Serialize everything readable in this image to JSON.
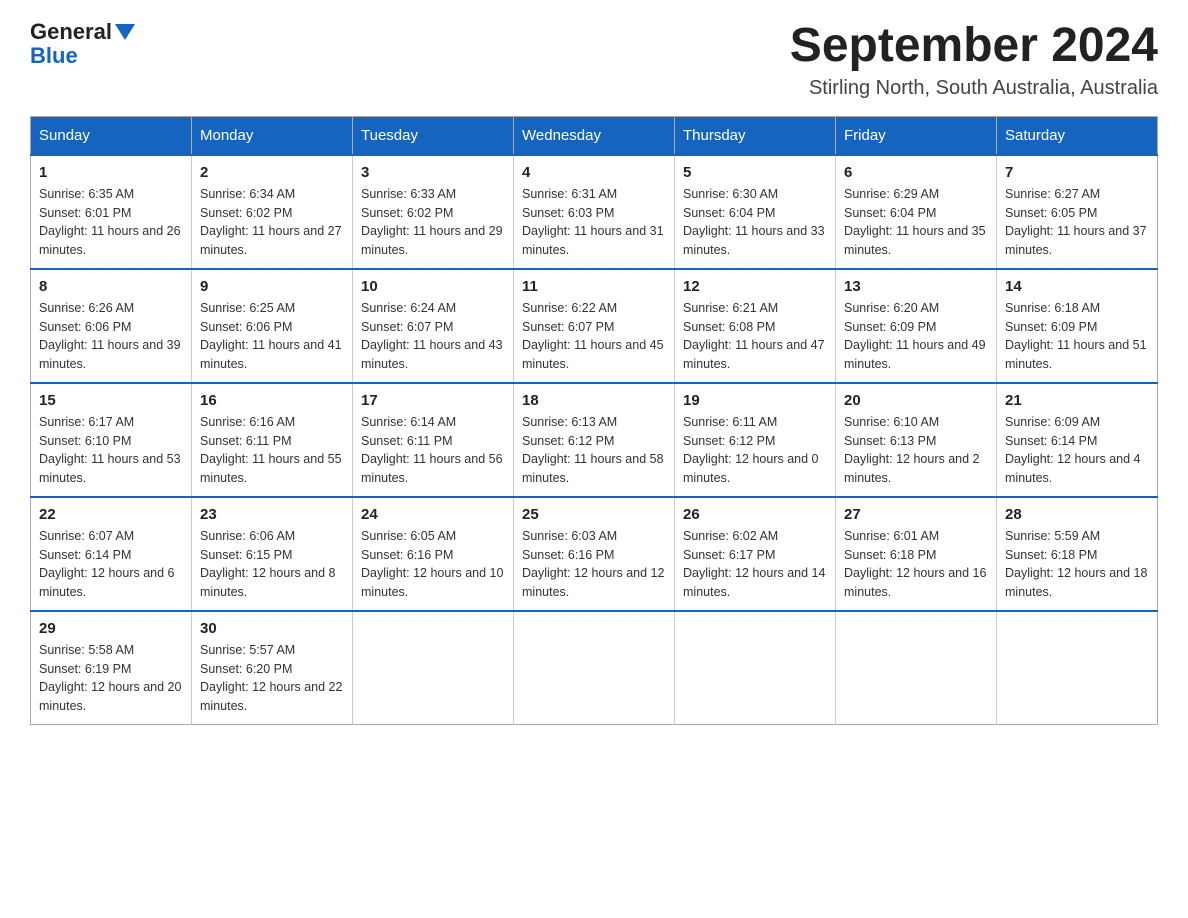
{
  "header": {
    "logo": {
      "general": "General",
      "blue": "Blue"
    },
    "title": "September 2024",
    "location": "Stirling North, South Australia, Australia"
  },
  "days_of_week": [
    "Sunday",
    "Monday",
    "Tuesday",
    "Wednesday",
    "Thursday",
    "Friday",
    "Saturday"
  ],
  "weeks": [
    [
      {
        "day": "1",
        "sunrise": "6:35 AM",
        "sunset": "6:01 PM",
        "daylight": "11 hours and 26 minutes."
      },
      {
        "day": "2",
        "sunrise": "6:34 AM",
        "sunset": "6:02 PM",
        "daylight": "11 hours and 27 minutes."
      },
      {
        "day": "3",
        "sunrise": "6:33 AM",
        "sunset": "6:02 PM",
        "daylight": "11 hours and 29 minutes."
      },
      {
        "day": "4",
        "sunrise": "6:31 AM",
        "sunset": "6:03 PM",
        "daylight": "11 hours and 31 minutes."
      },
      {
        "day": "5",
        "sunrise": "6:30 AM",
        "sunset": "6:04 PM",
        "daylight": "11 hours and 33 minutes."
      },
      {
        "day": "6",
        "sunrise": "6:29 AM",
        "sunset": "6:04 PM",
        "daylight": "11 hours and 35 minutes."
      },
      {
        "day": "7",
        "sunrise": "6:27 AM",
        "sunset": "6:05 PM",
        "daylight": "11 hours and 37 minutes."
      }
    ],
    [
      {
        "day": "8",
        "sunrise": "6:26 AM",
        "sunset": "6:06 PM",
        "daylight": "11 hours and 39 minutes."
      },
      {
        "day": "9",
        "sunrise": "6:25 AM",
        "sunset": "6:06 PM",
        "daylight": "11 hours and 41 minutes."
      },
      {
        "day": "10",
        "sunrise": "6:24 AM",
        "sunset": "6:07 PM",
        "daylight": "11 hours and 43 minutes."
      },
      {
        "day": "11",
        "sunrise": "6:22 AM",
        "sunset": "6:07 PM",
        "daylight": "11 hours and 45 minutes."
      },
      {
        "day": "12",
        "sunrise": "6:21 AM",
        "sunset": "6:08 PM",
        "daylight": "11 hours and 47 minutes."
      },
      {
        "day": "13",
        "sunrise": "6:20 AM",
        "sunset": "6:09 PM",
        "daylight": "11 hours and 49 minutes."
      },
      {
        "day": "14",
        "sunrise": "6:18 AM",
        "sunset": "6:09 PM",
        "daylight": "11 hours and 51 minutes."
      }
    ],
    [
      {
        "day": "15",
        "sunrise": "6:17 AM",
        "sunset": "6:10 PM",
        "daylight": "11 hours and 53 minutes."
      },
      {
        "day": "16",
        "sunrise": "6:16 AM",
        "sunset": "6:11 PM",
        "daylight": "11 hours and 55 minutes."
      },
      {
        "day": "17",
        "sunrise": "6:14 AM",
        "sunset": "6:11 PM",
        "daylight": "11 hours and 56 minutes."
      },
      {
        "day": "18",
        "sunrise": "6:13 AM",
        "sunset": "6:12 PM",
        "daylight": "11 hours and 58 minutes."
      },
      {
        "day": "19",
        "sunrise": "6:11 AM",
        "sunset": "6:12 PM",
        "daylight": "12 hours and 0 minutes."
      },
      {
        "day": "20",
        "sunrise": "6:10 AM",
        "sunset": "6:13 PM",
        "daylight": "12 hours and 2 minutes."
      },
      {
        "day": "21",
        "sunrise": "6:09 AM",
        "sunset": "6:14 PM",
        "daylight": "12 hours and 4 minutes."
      }
    ],
    [
      {
        "day": "22",
        "sunrise": "6:07 AM",
        "sunset": "6:14 PM",
        "daylight": "12 hours and 6 minutes."
      },
      {
        "day": "23",
        "sunrise": "6:06 AM",
        "sunset": "6:15 PM",
        "daylight": "12 hours and 8 minutes."
      },
      {
        "day": "24",
        "sunrise": "6:05 AM",
        "sunset": "6:16 PM",
        "daylight": "12 hours and 10 minutes."
      },
      {
        "day": "25",
        "sunrise": "6:03 AM",
        "sunset": "6:16 PM",
        "daylight": "12 hours and 12 minutes."
      },
      {
        "day": "26",
        "sunrise": "6:02 AM",
        "sunset": "6:17 PM",
        "daylight": "12 hours and 14 minutes."
      },
      {
        "day": "27",
        "sunrise": "6:01 AM",
        "sunset": "6:18 PM",
        "daylight": "12 hours and 16 minutes."
      },
      {
        "day": "28",
        "sunrise": "5:59 AM",
        "sunset": "6:18 PM",
        "daylight": "12 hours and 18 minutes."
      }
    ],
    [
      {
        "day": "29",
        "sunrise": "5:58 AM",
        "sunset": "6:19 PM",
        "daylight": "12 hours and 20 minutes."
      },
      {
        "day": "30",
        "sunrise": "5:57 AM",
        "sunset": "6:20 PM",
        "daylight": "12 hours and 22 minutes."
      },
      null,
      null,
      null,
      null,
      null
    ]
  ],
  "labels": {
    "sunrise": "Sunrise:",
    "sunset": "Sunset:",
    "daylight": "Daylight:"
  }
}
